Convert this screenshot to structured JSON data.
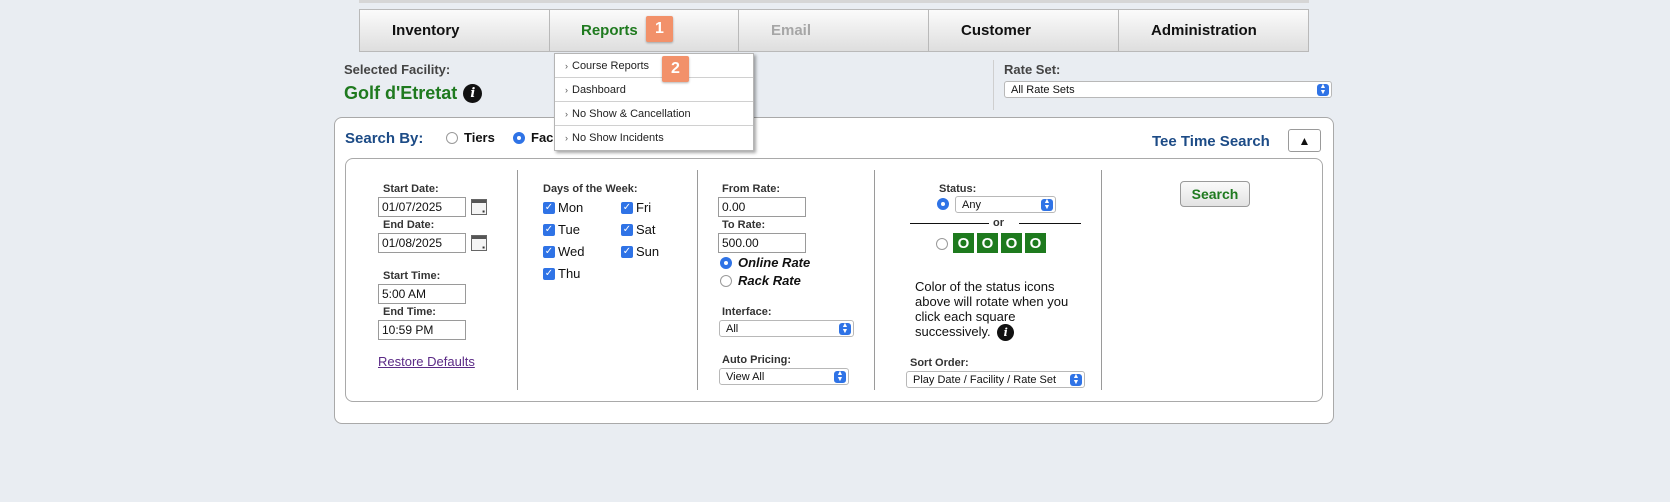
{
  "nav": {
    "tabs": [
      {
        "label": "Inventory"
      },
      {
        "label": "Reports"
      },
      {
        "label": "Email"
      },
      {
        "label": "Customer"
      },
      {
        "label": "Administration"
      }
    ]
  },
  "badges": [
    "1",
    "2"
  ],
  "reports_menu": {
    "items": [
      "Course Reports",
      "Dashboard",
      "No Show & Cancellation",
      "No Show Incidents"
    ]
  },
  "facility": {
    "label": "Selected Facility:",
    "name": "Golf d'Etretat"
  },
  "rate_set": {
    "label": "Rate Set:",
    "value": "All Rate Sets"
  },
  "search_by": {
    "label": "Search By:",
    "options": [
      "Tiers",
      "Fac"
    ],
    "selected": "Fac"
  },
  "tee_time_search": {
    "title": "Tee Time Search"
  },
  "dates": {
    "start_date_label": "Start Date:",
    "start_date": "01/07/2025",
    "end_date_label": "End Date:",
    "end_date": "01/08/2025",
    "start_time_label": "Start Time:",
    "start_time": "5:00 AM",
    "end_time_label": "End Time:",
    "end_time": "10:59 PM",
    "restore_label": "Restore Defaults"
  },
  "days": {
    "label": "Days of the Week:",
    "mon": "Mon",
    "tue": "Tue",
    "wed": "Wed",
    "thu": "Thu",
    "fri": "Fri",
    "sat": "Sat",
    "sun": "Sun"
  },
  "rates": {
    "from_label": "From Rate:",
    "from_value": "0.00",
    "to_label": "To Rate:",
    "to_value": "500.00",
    "online_label": "Online Rate",
    "rack_label": "Rack Rate",
    "interface_label": "Interface:",
    "interface_value": "All",
    "auto_pricing_label": "Auto Pricing:",
    "auto_pricing_value": "View All"
  },
  "status": {
    "label": "Status:",
    "value": "Any",
    "or_label": "or",
    "squares": [
      "O",
      "O",
      "O",
      "O"
    ],
    "note": "Color of the status icons above will rotate when you click each square successively.",
    "sort_label": "Sort Order:",
    "sort_value": "Play Date / Facility / Rate Set"
  },
  "search_button": "Search",
  "colors": {
    "accent_green": "#1f7a1f",
    "heading_blue": "#1c4b86",
    "badge_orange": "#f2916a",
    "check_blue": "#2f73e6"
  }
}
